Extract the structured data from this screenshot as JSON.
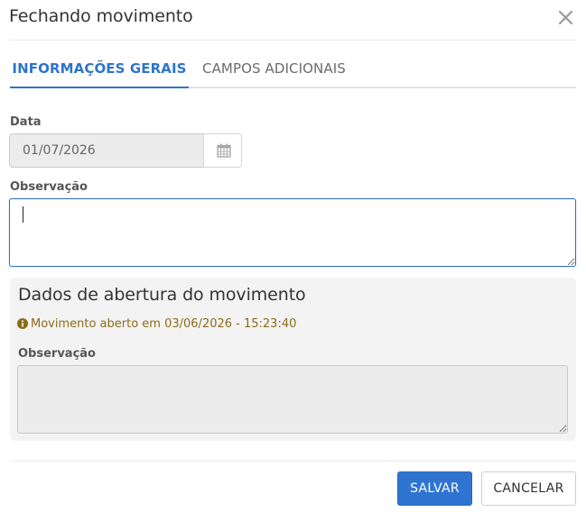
{
  "modal": {
    "title": "Fechando movimento",
    "close_icon": "close-icon"
  },
  "tabs": [
    {
      "label": "INFORMAÇÕES GERAIS",
      "active": true
    },
    {
      "label": "CAMPOS ADICIONAIS",
      "active": false
    }
  ],
  "form": {
    "date_label": "Data",
    "date_value": "01/07/2026",
    "date_icon": "calendar-icon",
    "obs_label": "Observação",
    "obs_value": ""
  },
  "opening": {
    "title": "Dados de abertura do movimento",
    "info_icon": "info-icon",
    "info_text": "Movimento aberto em 03/06/2026 - 15:23:40",
    "obs_label": "Observação",
    "obs_value": ""
  },
  "footer": {
    "save_label": "SALVAR",
    "cancel_label": "CANCELAR"
  },
  "colors": {
    "accent": "#2f74c9",
    "info_text": "#8a6d1a",
    "panel_bg": "#f3f3f3"
  }
}
